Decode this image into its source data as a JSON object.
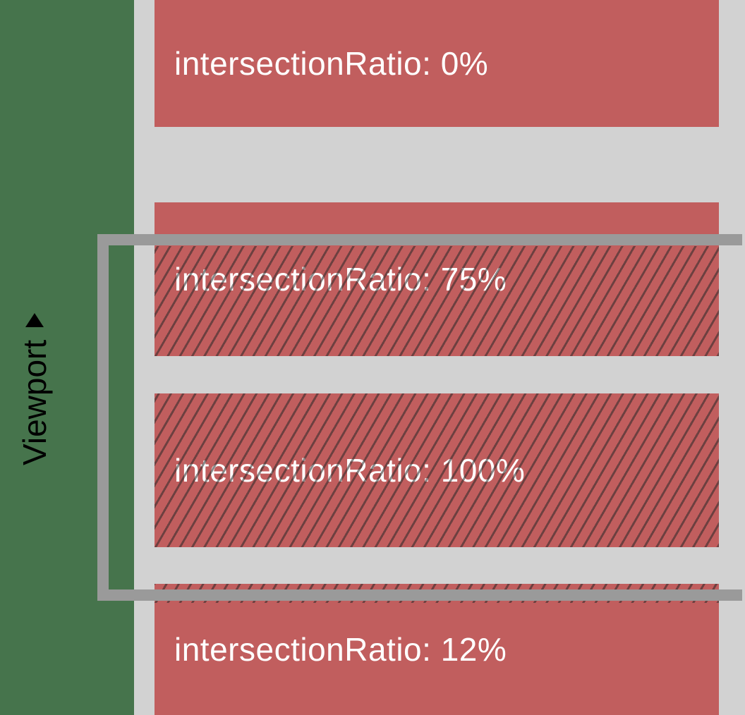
{
  "label_prefix": "intersectionRatio: ",
  "cards": [
    {
      "ratio_text": "0%",
      "intersecting": false
    },
    {
      "ratio_text": "75%",
      "intersecting": true
    },
    {
      "ratio_text": "100%",
      "intersecting": true
    },
    {
      "ratio_text": "12%",
      "intersecting": true
    }
  ],
  "viewport_label": "Viewport",
  "colors": {
    "surround": "#46744c",
    "page": "#d2d2d2",
    "card": "#c15e5e",
    "text": "#ffffff",
    "viewport_border": "#9a9a9a"
  }
}
